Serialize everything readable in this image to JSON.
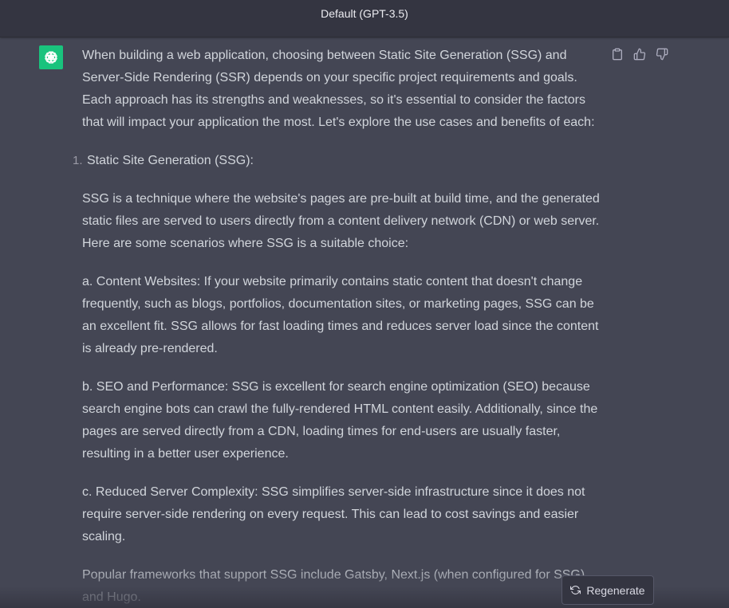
{
  "header": {
    "model_title": "Default (GPT-3.5)"
  },
  "message": {
    "intro": "When building a web application, choosing between Static Site Generation (SSG) and Server-Side Rendering (SSR) depends on your specific project requirements and goals. Each approach has its strengths and weaknesses, so it's essential to consider the factors that will impact your application the most. Let's explore the use cases and benefits of each:",
    "list_number": "1.",
    "list_heading": "Static Site Generation (SSG):",
    "ssg_definition": "SSG is a technique where the website's pages are pre-built at build time, and the generated static files are served to users directly from a content delivery network (CDN) or web server. Here are some scenarios where SSG is a suitable choice:",
    "point_a": "a. Content Websites: If your website primarily contains static content that doesn't change frequently, such as blogs, portfolios, documentation sites, or marketing pages, SSG can be an excellent fit. SSG allows for fast loading times and reduces server load since the content is already pre-rendered.",
    "point_b": "b. SEO and Performance: SSG is excellent for search engine optimization (SEO) because search engine bots can crawl the fully-rendered HTML content easily. Additionally, since the pages are served directly from a CDN, loading times for end-users are usually faster, resulting in a better user experience.",
    "point_c": "c. Reduced Server Complexity: SSG simplifies server-side infrastructure since it does not require server-side rendering on every request. This can lead to cost savings and easier scaling.",
    "frameworks": "Popular frameworks that support SSG include Gatsby, Next.js (when configured for SSG), and Hugo."
  },
  "actions": {
    "copy_icon": "clipboard-icon",
    "like_icon": "thumbs-up-icon",
    "dislike_icon": "thumbs-down-icon"
  },
  "regenerate": {
    "label": "Regenerate",
    "icon": "refresh-icon"
  },
  "colors": {
    "header_bg": "#343541",
    "message_bg": "#444654",
    "text": "#d1d5db",
    "avatar_bg": "#19c37d"
  }
}
